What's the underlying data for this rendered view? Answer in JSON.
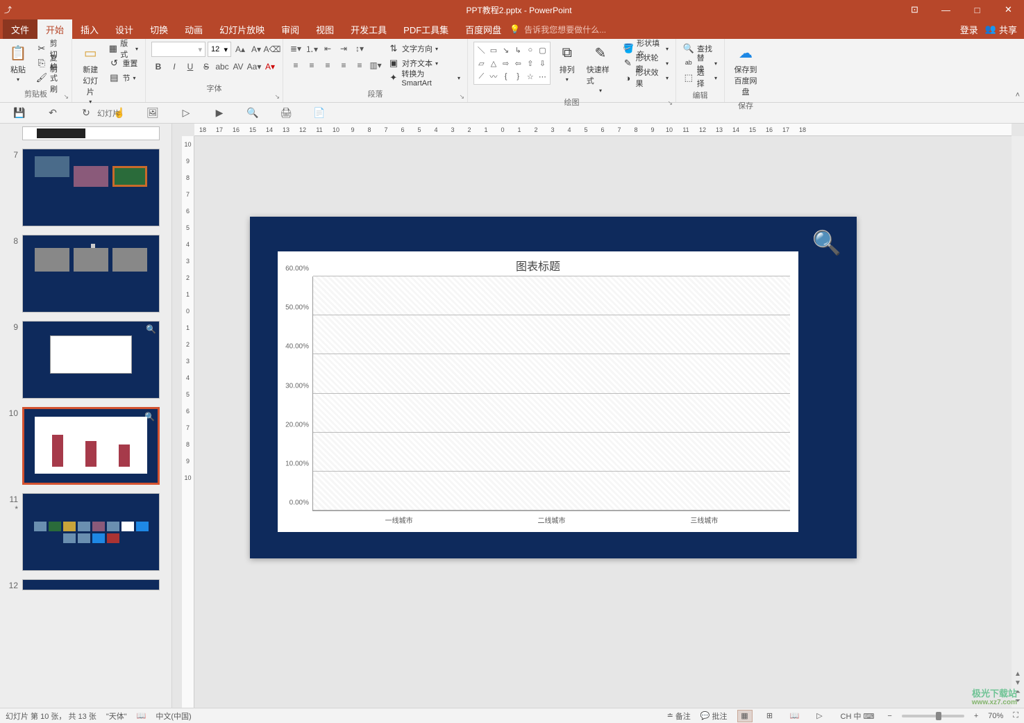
{
  "title": "PPT教程2.pptx - PowerPoint",
  "window_buttons": {
    "options": "⊡",
    "min": "—",
    "max": "□",
    "close": "✕"
  },
  "tabs": {
    "file": "文件",
    "home": "开始",
    "insert": "插入",
    "design": "设计",
    "transitions": "切换",
    "animations": "动画",
    "slideshow": "幻灯片放映",
    "review": "审阅",
    "view": "视图",
    "developer": "开发工具",
    "pdf": "PDF工具集",
    "baidu": "百度网盘",
    "tellme_placeholder": "告诉我您想要做什么...",
    "login": "登录",
    "share": "共享"
  },
  "ribbon": {
    "clipboard": {
      "label": "剪贴板",
      "paste": "粘贴",
      "cut": "剪切",
      "copy": "复制",
      "painter": "格式刷"
    },
    "slides": {
      "label": "幻灯片",
      "newslide": "新建\n幻灯片",
      "layout": "版式",
      "reset": "重置",
      "section": "节"
    },
    "font": {
      "label": "字体",
      "size": "12"
    },
    "paragraph": {
      "label": "段落",
      "dir": "文字方向",
      "align": "对齐文本",
      "smartart": "转换为 SmartArt"
    },
    "drawing": {
      "label": "绘图",
      "arrange": "排列",
      "quickstyles": "快速样式",
      "fill": "形状填充",
      "outline": "形状轮廓",
      "effects": "形状效果"
    },
    "editing": {
      "label": "编辑",
      "find": "查找",
      "replace": "替换",
      "select": "选择"
    },
    "save": {
      "label": "保存",
      "baidu": "保存到\n百度网盘"
    }
  },
  "ruler_h": [
    "18",
    "17",
    "16",
    "15",
    "14",
    "13",
    "12",
    "11",
    "10",
    "9",
    "8",
    "7",
    "6",
    "5",
    "4",
    "3",
    "2",
    "1",
    "0",
    "1",
    "2",
    "3",
    "4",
    "5",
    "6",
    "7",
    "8",
    "9",
    "10",
    "11",
    "12",
    "13",
    "14",
    "15",
    "16",
    "17",
    "18"
  ],
  "ruler_v": [
    "10",
    "9",
    "8",
    "7",
    "6",
    "5",
    "4",
    "3",
    "2",
    "1",
    "0",
    "1",
    "2",
    "3",
    "4",
    "5",
    "6",
    "7",
    "8",
    "9",
    "10"
  ],
  "thumbs": {
    "n7": "7",
    "n8": "8",
    "n9": "9",
    "n10": "10",
    "n11": "11",
    "n12": "12",
    "anim": "*"
  },
  "chart_data": {
    "type": "bar",
    "title": "图表标题",
    "categories": [
      "一线城市",
      "二线城市",
      "三线城市"
    ],
    "values": [
      57.0,
      46.0,
      40.0
    ],
    "ylabels": [
      "0.00%",
      "10.00%",
      "20.00%",
      "30.00%",
      "40.00%",
      "50.00%",
      "60.00%"
    ],
    "ylim": [
      0,
      60
    ],
    "color": "#a63a4a"
  },
  "status": {
    "slide_info": "幻灯片 第 10 张， 共 13 张",
    "theme": "\"天体\"",
    "lang": "中文(中国)",
    "notes": "备注",
    "comments": "批注",
    "zoom": "70%",
    "ime": "CH 中 ⌨"
  },
  "watermark": {
    "l1": "极光下载站",
    "l2": "www.xz7.com"
  }
}
